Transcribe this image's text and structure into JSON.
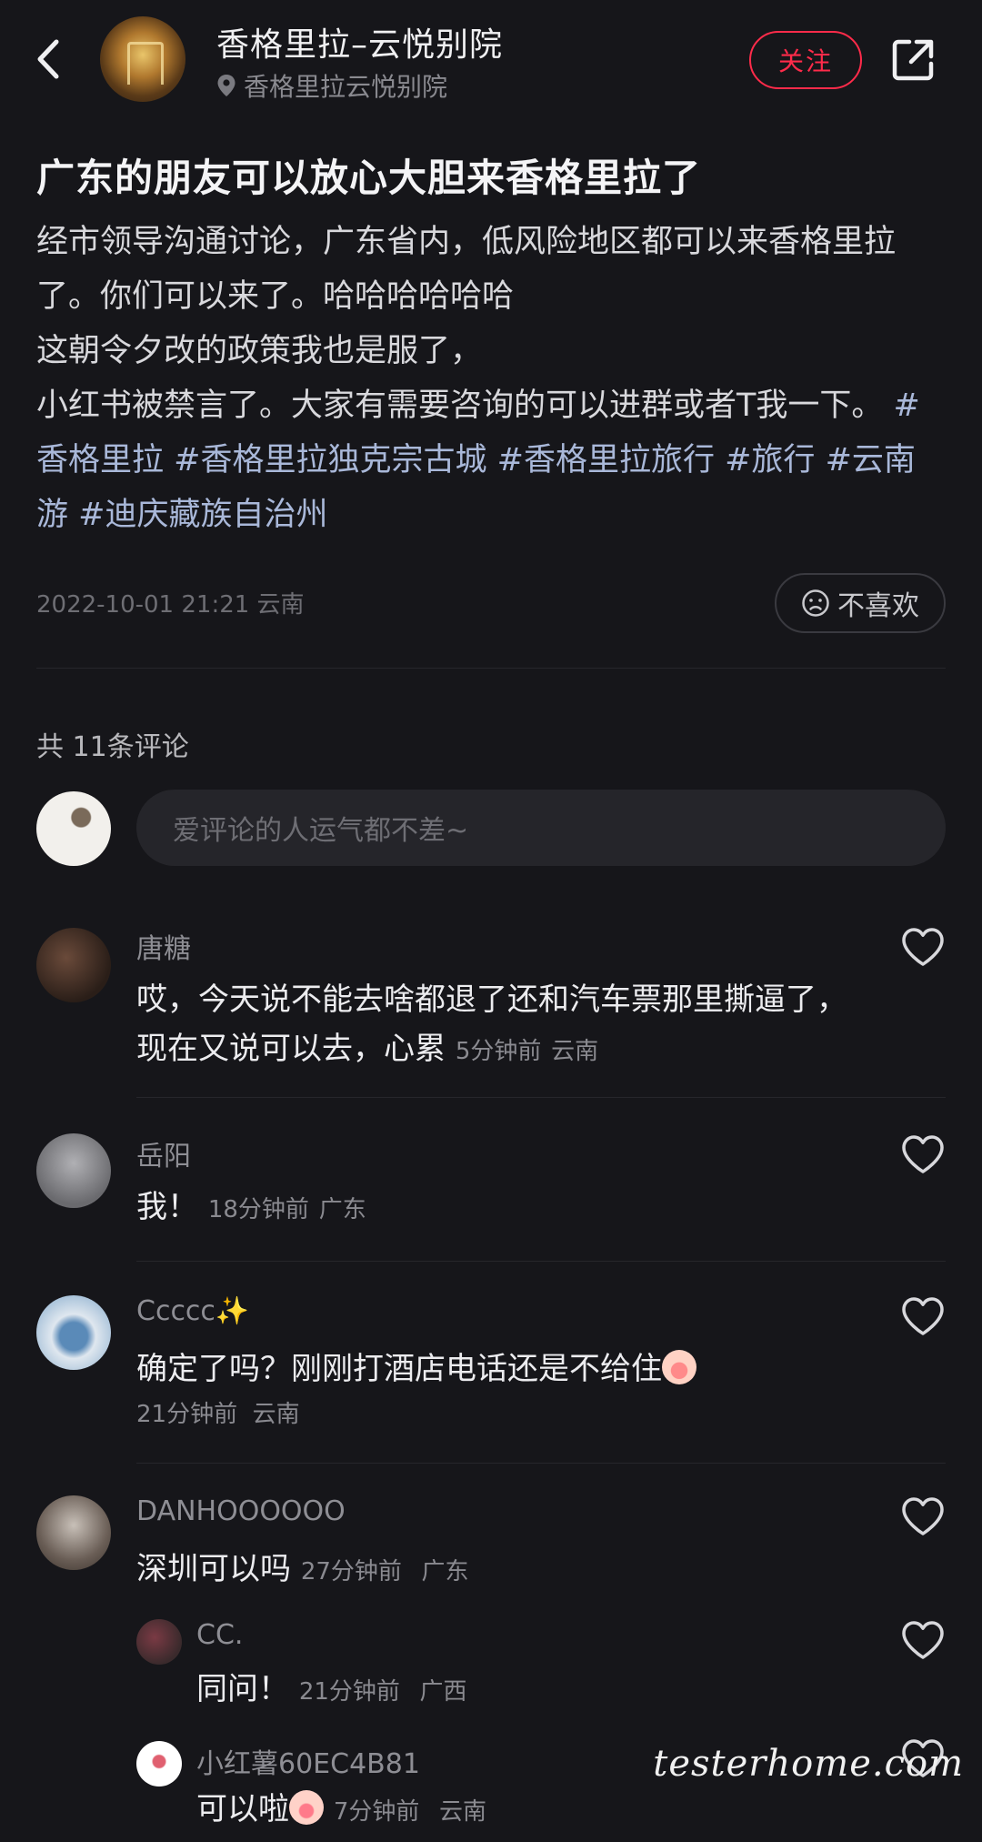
{
  "header": {
    "title": "香格里拉–云悦别院",
    "location": "香格里拉云悦别院",
    "follow_label": "关注"
  },
  "post": {
    "title": "广东的朋友可以放心大胆来香格里拉了",
    "line1": "经市领导沟通讨论，广东省内，低风险地区都可以来香格里拉了。你们可以来了。哈哈哈哈哈哈",
    "line2": "这朝令夕改的政策我也是服了，",
    "line3": "小红书被禁言了。大家有需要咨询的可以进群或者T我一下。",
    "tags": [
      "#香格里拉",
      "#香格里拉独克宗古城",
      "#香格里拉旅行",
      "#旅行",
      "#云南游",
      "#迪庆藏族自治州"
    ],
    "meta": "2022-10-01 21:21 云南",
    "dislike_label": "不喜欢"
  },
  "comments_section": {
    "count_label": "共 11条评论",
    "input_placeholder": "爱评论的人运气都不差~"
  },
  "comments": [
    {
      "name": "唐糖",
      "text": "哎，今天说不能去啥都退了还和汽车票那里撕逼了，现在又说可以去，心累",
      "time": "5分钟前",
      "region": "云南"
    },
    {
      "name": "岳阳",
      "text": "我！",
      "time": "18分钟前",
      "region": "广东"
    },
    {
      "name": "Ccccc✨",
      "text": "确定了吗？刚刚打酒店电话还是不给住",
      "time": "21分钟前",
      "region": "云南"
    },
    {
      "name": "DANHOOOOOO",
      "text": "深圳可以吗",
      "time": "27分钟前",
      "region": "广东"
    }
  ],
  "replies": [
    {
      "name": "CC.",
      "text": "同问！",
      "time": "21分钟前",
      "region": "广西"
    },
    {
      "name": "小红薯60EC4B81",
      "text": "可以啦",
      "time": "7分钟前",
      "region": "云南"
    }
  ],
  "watermark": "testerhome.com",
  "colors": {
    "background": "#16161a",
    "accent": "#ff2b4a",
    "tag": "#a9b8d9"
  }
}
